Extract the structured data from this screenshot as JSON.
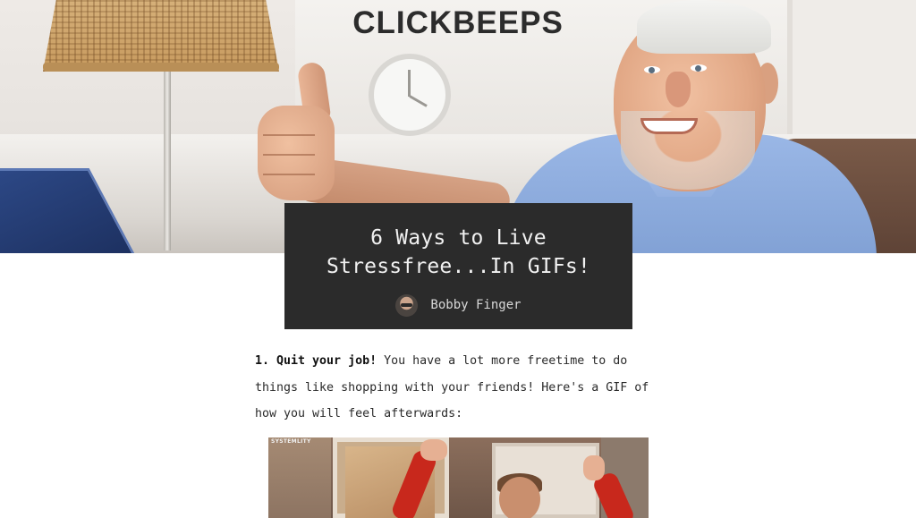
{
  "site": {
    "brand": "CLICKBEEPS"
  },
  "post": {
    "title": "6 Ways to Live Stressfree...In GIFs!",
    "author": "Bobby Finger"
  },
  "article": {
    "item1_heading": "1. Quit your job!",
    "item1_text": " You have a lot more freetime to do things like shopping with your friends! Here's a GIF of how you will feel afterwards:"
  },
  "gif": {
    "watermark": "SYSTEMLITY"
  },
  "colors": {
    "title_card_bg": "#2b2b2b",
    "brand_text": "#2c2c2c",
    "body_text": "#2a2a2a",
    "page_bg": "#ffffff"
  }
}
